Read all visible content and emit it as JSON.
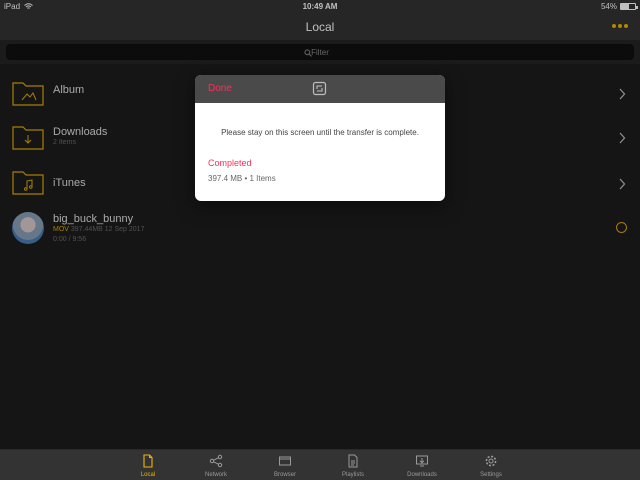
{
  "status": {
    "device": "iPad",
    "time": "10:49 AM",
    "battery": "54%",
    "battery_level": 0.54
  },
  "nav": {
    "title": "Local"
  },
  "filter": {
    "placeholder": "Filter"
  },
  "items": [
    {
      "title": "Album",
      "subtitle": ""
    },
    {
      "title": "Downloads",
      "subtitle": "2 Items"
    },
    {
      "title": "iTunes",
      "subtitle": ""
    }
  ],
  "video": {
    "title": "big_buck_bunny",
    "format": "MOV",
    "meta": "397.44MB 12 Sep 2017",
    "progress": "0:00 / 9:56"
  },
  "dialog": {
    "done_label": "Done",
    "message": "Please stay on this screen until the transfer is complete.",
    "status": "Completed",
    "detail": "397.4 MB • 1 Items"
  },
  "tabs": [
    {
      "label": "Local",
      "icon": "file-icon",
      "active": true
    },
    {
      "label": "Network",
      "icon": "share-icon",
      "active": false
    },
    {
      "label": "Browser",
      "icon": "browser-icon",
      "active": false
    },
    {
      "label": "Playlists",
      "icon": "playlist-icon",
      "active": false
    },
    {
      "label": "Downloads",
      "icon": "download-icon",
      "active": false
    },
    {
      "label": "Settings",
      "icon": "gear-icon",
      "active": false
    }
  ],
  "colors": {
    "accent": "#f0b400",
    "danger": "#ff2d55",
    "bar": "#333333",
    "background": "#1c1c1c"
  }
}
